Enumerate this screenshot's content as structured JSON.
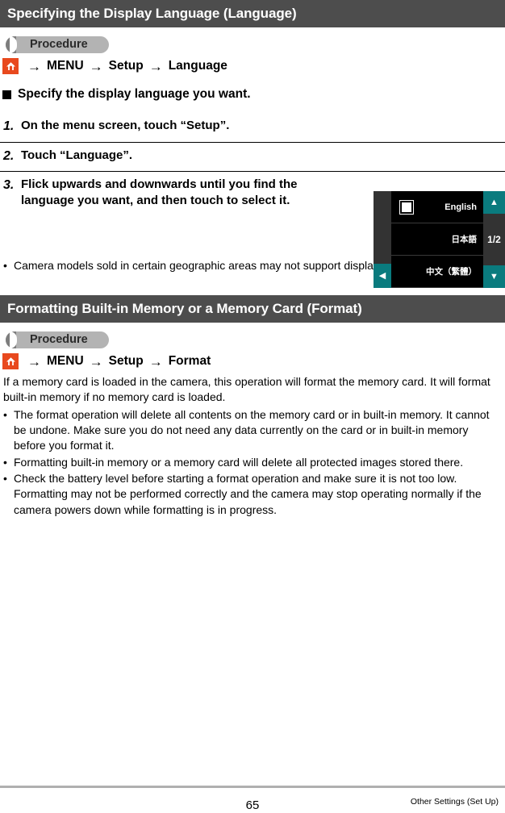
{
  "section1": {
    "title": "Specifying the Display Language (Language)",
    "procedure_label": "Procedure",
    "menu_path": {
      "home_icon": "home-icon",
      "arrow": "→",
      "item1": "MENU",
      "item2": "Setup",
      "item3": "Language"
    },
    "subheading": "Specify the display language you want.",
    "steps": [
      {
        "num": "1.",
        "text": "On the menu screen, touch “Setup”."
      },
      {
        "num": "2.",
        "text": "Touch “Language”."
      },
      {
        "num": "3.",
        "text": "Flick upwards and downwards until you find the language you want, and then touch to select it."
      }
    ],
    "camera_screen": {
      "rows": [
        "English",
        "日本語",
        "中文（繁體）"
      ],
      "selected_row": "English",
      "page_indicator": "1/2",
      "up_arrow": "▲",
      "down_arrow": "▼",
      "back_arrow": "◀",
      "accent_color": "#0a7b7e"
    },
    "notes": [
      "Camera models sold in certain geographic areas may not support display language selection."
    ]
  },
  "section2": {
    "title": "Formatting Built-in Memory or a Memory Card (Format)",
    "procedure_label": "Procedure",
    "menu_path": {
      "home_icon": "home-icon",
      "arrow": "→",
      "item1": "MENU",
      "item2": "Setup",
      "item3": "Format"
    },
    "paragraph": "If a memory card is loaded in the camera, this operation will format the memory card. It will format built-in memory if no memory card is loaded.",
    "notes": [
      "The format operation will delete all contents on the memory card or in built-in memory. It cannot be undone. Make sure you do not need any data currently on the card or in built-in memory before you format it.",
      "Formatting built-in memory or a memory card will delete all protected images stored there.",
      "Check the battery level before starting a format operation and make sure it is not too low. Formatting may not be performed correctly and the camera may stop operating normally if the camera powers down while formatting is in progress."
    ]
  },
  "footer": {
    "page_number": "65",
    "caption": "Other Settings (Set Up)"
  },
  "bullet_char": "•"
}
